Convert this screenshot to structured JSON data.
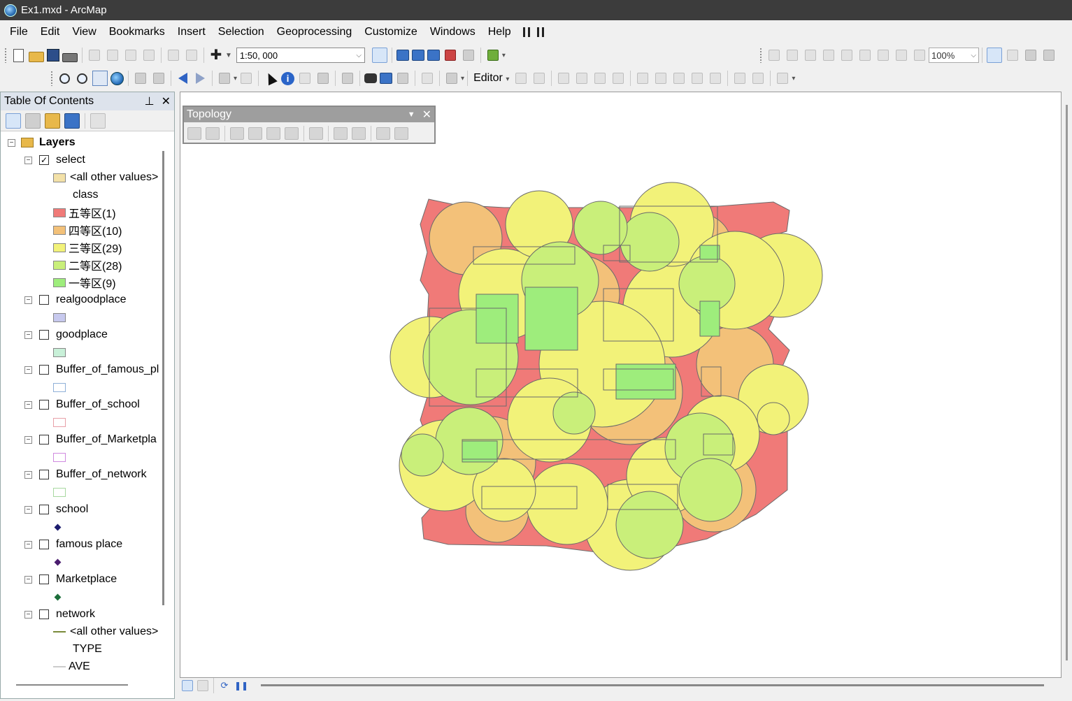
{
  "window": {
    "title": "Ex1.mxd - ArcMap"
  },
  "menu": [
    "File",
    "Edit",
    "View",
    "Bookmarks",
    "Insert",
    "Selection",
    "Geoprocessing",
    "Customize",
    "Windows",
    "Help"
  ],
  "toolbar": {
    "scale_value": "1:50, 000",
    "layout_zoom": "100%",
    "editor_label": "Editor"
  },
  "toc": {
    "title": "Table Of Contents",
    "root_label": "Layers",
    "layers": [
      {
        "name": "select",
        "checked": true,
        "legend": [
          {
            "label": "<all other values>",
            "color": "#f3e1a8"
          },
          {
            "label": "class",
            "heading": true
          },
          {
            "label": "五等区(1)",
            "color": "#f07a78"
          },
          {
            "label": "四等区(10)",
            "color": "#f3c179"
          },
          {
            "label": "三等区(29)",
            "color": "#f2f279"
          },
          {
            "label": "二等区(28)",
            "color": "#c9ef7a"
          },
          {
            "label": "一等区(9)",
            "color": "#9eed7c"
          }
        ]
      },
      {
        "name": "realgoodplace",
        "checked": false,
        "legend": [
          {
            "color": "#c7c9ee"
          }
        ]
      },
      {
        "name": "goodplace",
        "checked": false,
        "legend": [
          {
            "color": "#c8f0d8"
          }
        ]
      },
      {
        "name": "Buffer_of_famous_pl",
        "checked": false,
        "legend": [
          {
            "color": "#ffffff",
            "outline": "#8fb0d8"
          }
        ]
      },
      {
        "name": "Buffer_of_school",
        "checked": false,
        "legend": [
          {
            "color": "#ffffff",
            "outline": "#e8a0a8"
          }
        ]
      },
      {
        "name": "Buffer_of_Marketpla",
        "checked": false,
        "legend": [
          {
            "color": "#ffffff",
            "outline": "#d08ae0"
          }
        ]
      },
      {
        "name": "Buffer_of_network",
        "checked": false,
        "legend": [
          {
            "color": "#ffffff",
            "outline": "#a8d8a0"
          }
        ]
      },
      {
        "name": "school",
        "checked": false,
        "legend": [
          {
            "marker": "#1c1c6e"
          }
        ]
      },
      {
        "name": "famous place",
        "checked": false,
        "legend": [
          {
            "marker": "#4a1c6e"
          }
        ]
      },
      {
        "name": "Marketplace",
        "checked": false,
        "legend": [
          {
            "marker": "#1c6e3a"
          }
        ]
      },
      {
        "name": "network",
        "checked": false,
        "legend": [
          {
            "label": "<all other values>",
            "line": "#7a8a3a"
          },
          {
            "label": "TYPE",
            "heading": true
          },
          {
            "label": "AVE",
            "line": "#cccccc"
          }
        ]
      }
    ]
  },
  "topology": {
    "title": "Topology"
  },
  "map": {
    "palette": {
      "class5": "#f07a78",
      "class4": "#f3c179",
      "class3": "#f2f279",
      "class2": "#c9ef7a",
      "class1": "#9eed7c"
    }
  }
}
